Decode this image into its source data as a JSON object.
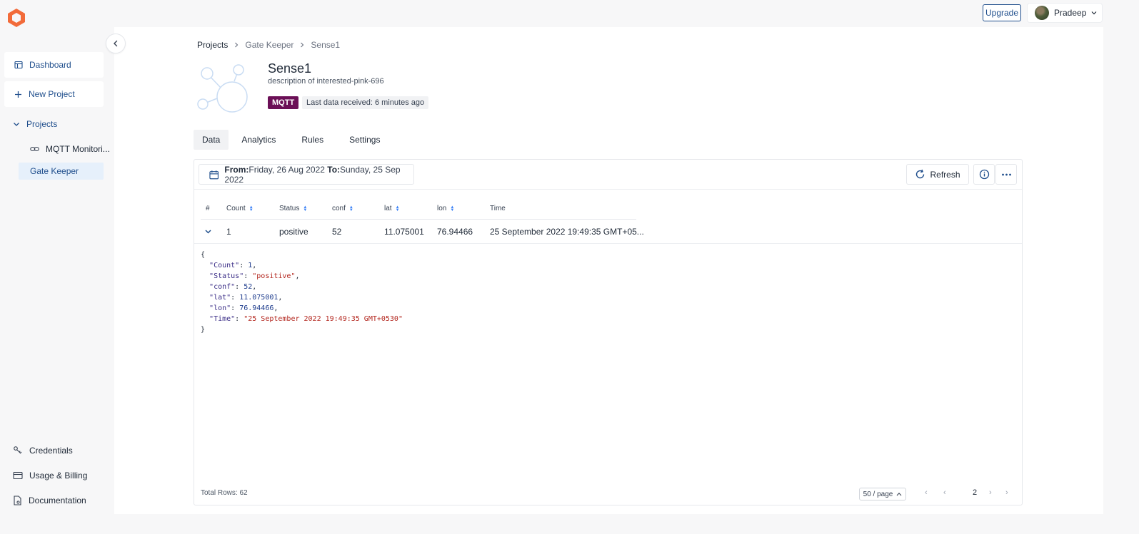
{
  "app": {
    "upgrade_label": "Upgrade",
    "user_name": "Pradeep",
    "brand_color": "#f26b3a",
    "accent_color": "#1f4e8c"
  },
  "sidebar": {
    "dashboard_label": "Dashboard",
    "new_project_label": "New Project",
    "projects_label": "Projects",
    "project_items": [
      {
        "label": "MQTT Monitori..."
      },
      {
        "label": "Gate Keeper",
        "active": true
      }
    ],
    "bottom_items": [
      {
        "label": "Credentials",
        "icon": "key-icon"
      },
      {
        "label": "Usage & Billing",
        "icon": "credit-card-icon"
      },
      {
        "label": "Documentation",
        "icon": "document-icon"
      }
    ]
  },
  "breadcrumb": [
    "Projects",
    "Gate Keeper",
    "Sense1"
  ],
  "project": {
    "title": "Sense1",
    "description": "description of interested-pink-696",
    "protocol_tag": "MQTT",
    "last_data": "Last data received: 6 minutes ago"
  },
  "tabs": [
    {
      "label": "Data",
      "active": true
    },
    {
      "label": "Analytics"
    },
    {
      "label": "Rules"
    },
    {
      "label": "Settings"
    }
  ],
  "toolbar": {
    "from_label": "From:",
    "from_value": "Friday, 26 Aug 2022",
    "to_label": "To:",
    "to_value": "Sunday, 25 Sep 2022",
    "refresh_label": "Refresh"
  },
  "table": {
    "columns": [
      "#",
      "Count",
      "Status",
      "conf",
      "lat",
      "lon",
      "Time"
    ],
    "rows": [
      {
        "count": "1",
        "status": "positive",
        "conf": "52",
        "lat": "11.075001",
        "lon": "76.94466",
        "time": "25 September 2022 19:49:35 GMT+05..."
      }
    ],
    "expanded_json": {
      "open": "{",
      "count_key": "\"Count\"",
      "count_val": "1",
      "status_key": "\"Status\"",
      "status_val": "\"positive\"",
      "conf_key": "\"conf\"",
      "conf_val": "52",
      "lat_key": "\"lat\"",
      "lat_val": "11.075001",
      "lon_key": "\"lon\"",
      "lon_val": "76.94466",
      "time_key": "\"Time\"",
      "time_val": "\"25 September 2022 19:49:35 GMT+0530\"",
      "close": "}"
    }
  },
  "footer": {
    "total_rows": "Total Rows: 62",
    "page_size": "50 / page",
    "page_number": "2"
  }
}
